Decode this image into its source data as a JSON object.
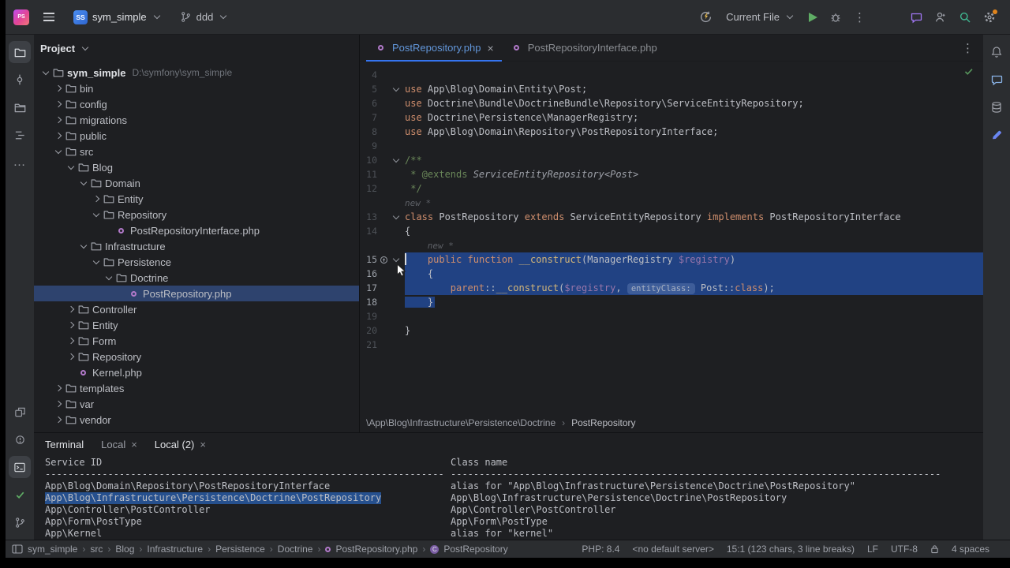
{
  "palette": {
    "accent": "#3574f0",
    "sel": "#214283",
    "treesel": "#2e436e",
    "termsel": "#26508e",
    "modblue": "#6296d9",
    "php": "#b179c9",
    "green": "#5fad65",
    "checkgreen": "#57965c",
    "teal": "#3fb58f",
    "aipurple": "#a177f4",
    "orange": "#e0841c",
    "bolt": "#f0c050"
  },
  "toolbar": {
    "app_initials": "PS",
    "project_badge": "SS",
    "project_name": "sym_simple",
    "vcs_branch": "ddd",
    "run_config": "Current File"
  },
  "left_bar": {
    "top": [
      "project",
      "commit",
      "packages",
      "structure",
      "more"
    ],
    "bottom": [
      "services",
      "problems",
      "terminal",
      "checks",
      "vcs"
    ],
    "active": [
      "project",
      "terminal"
    ]
  },
  "right_bar": [
    "notifications",
    "ai-assistant",
    "database",
    "ai-edit"
  ],
  "project": {
    "title": "Project",
    "tree": [
      {
        "label": "sym_simple",
        "depth": 0,
        "kind": "root",
        "state": "open",
        "suffix": "D:\\symfony\\sym_simple"
      },
      {
        "label": "bin",
        "depth": 1,
        "kind": "folder",
        "state": "closed"
      },
      {
        "label": "config",
        "depth": 1,
        "kind": "folder",
        "state": "closed"
      },
      {
        "label": "migrations",
        "depth": 1,
        "kind": "folder",
        "state": "closed"
      },
      {
        "label": "public",
        "depth": 1,
        "kind": "folder",
        "state": "closed"
      },
      {
        "label": "src",
        "depth": 1,
        "kind": "folder",
        "state": "open"
      },
      {
        "label": "Blog",
        "depth": 2,
        "kind": "folder",
        "state": "open"
      },
      {
        "label": "Domain",
        "depth": 3,
        "kind": "folder",
        "state": "open"
      },
      {
        "label": "Entity",
        "depth": 4,
        "kind": "folder",
        "state": "closed"
      },
      {
        "label": "Repository",
        "depth": 4,
        "kind": "folder",
        "state": "open"
      },
      {
        "label": "PostRepositoryInterface.php",
        "depth": 5,
        "kind": "file"
      },
      {
        "label": "Infrastructure",
        "depth": 3,
        "kind": "folder",
        "state": "open"
      },
      {
        "label": "Persistence",
        "depth": 4,
        "kind": "folder",
        "state": "open"
      },
      {
        "label": "Doctrine",
        "depth": 5,
        "kind": "folder",
        "state": "open"
      },
      {
        "label": "PostRepository.php",
        "depth": 6,
        "kind": "file",
        "selected": true
      },
      {
        "label": "Controller",
        "depth": 2,
        "kind": "folder",
        "state": "closed"
      },
      {
        "label": "Entity",
        "depth": 2,
        "kind": "folder",
        "state": "closed"
      },
      {
        "label": "Form",
        "depth": 2,
        "kind": "folder",
        "state": "closed"
      },
      {
        "label": "Repository",
        "depth": 2,
        "kind": "folder",
        "state": "closed"
      },
      {
        "label": "Kernel.php",
        "depth": 2,
        "kind": "file"
      },
      {
        "label": "templates",
        "depth": 1,
        "kind": "folder",
        "state": "closed"
      },
      {
        "label": "var",
        "depth": 1,
        "kind": "folder",
        "state": "closed"
      },
      {
        "label": "vendor",
        "depth": 1,
        "kind": "folder",
        "state": "closed"
      }
    ]
  },
  "editor": {
    "tabs": [
      {
        "label": "PostRepository.php",
        "active": true,
        "closable": true
      },
      {
        "label": "PostRepositoryInterface.php",
        "active": false
      }
    ],
    "lines": [
      {
        "n": 4,
        "tokens": []
      },
      {
        "n": 5,
        "fold": true,
        "tokens": [
          [
            "kw",
            "use"
          ],
          [
            "t",
            " App\\Blog\\Domain\\Entity\\Post;"
          ]
        ]
      },
      {
        "n": 6,
        "tokens": [
          [
            "kw",
            "use"
          ],
          [
            "t",
            " Doctrine\\Bundle\\DoctrineBundle\\Repository\\ServiceEntityRepository;"
          ]
        ]
      },
      {
        "n": 7,
        "tokens": [
          [
            "kw",
            "use"
          ],
          [
            "t",
            " Doctrine\\Persistence\\ManagerRegistry;"
          ]
        ]
      },
      {
        "n": 8,
        "tokens": [
          [
            "kw",
            "use"
          ],
          [
            "t",
            " App\\Blog\\Domain\\Repository\\PostRepositoryInterface;"
          ]
        ]
      },
      {
        "n": 9,
        "tokens": []
      },
      {
        "n": 10,
        "fold": true,
        "tokens": [
          [
            "doc",
            "/**"
          ]
        ]
      },
      {
        "n": 11,
        "tokens": [
          [
            "doc",
            " * @extends "
          ],
          [
            "docref",
            "ServiceEntityRepository<Post>"
          ]
        ]
      },
      {
        "n": 12,
        "tokens": [
          [
            "doc",
            " */"
          ]
        ]
      },
      {
        "cv": "new *",
        "indent": 0
      },
      {
        "n": 13,
        "fold": true,
        "tokens": [
          [
            "kw",
            "class"
          ],
          [
            "t",
            " PostRepository "
          ],
          [
            "kw",
            "extends"
          ],
          [
            "t",
            " ServiceEntityRepository "
          ],
          [
            "kw",
            "implements"
          ],
          [
            "t",
            " PostRepositoryInterface"
          ]
        ]
      },
      {
        "n": 14,
        "tokens": [
          [
            "t",
            "{"
          ]
        ]
      },
      {
        "cv": "new *",
        "indent": 4
      },
      {
        "n": 15,
        "hl": true,
        "sel": "full",
        "fold": true,
        "gutter": "impl",
        "caret": true,
        "tokens": [
          [
            "t",
            "    "
          ],
          [
            "kw",
            "public"
          ],
          [
            "t",
            " "
          ],
          [
            "kw",
            "function"
          ],
          [
            "t",
            " "
          ],
          [
            "fn",
            "__construct"
          ],
          [
            "t",
            "(ManagerRegistry "
          ],
          [
            "var",
            "$registry"
          ],
          [
            "t",
            ")"
          ]
        ]
      },
      {
        "n": 16,
        "hl": true,
        "sel": "full",
        "tokens": [
          [
            "t",
            "    {"
          ]
        ]
      },
      {
        "n": 17,
        "hl": true,
        "sel": "full",
        "tokens": [
          [
            "t",
            "        "
          ],
          [
            "kw",
            "parent"
          ],
          [
            "t",
            "::"
          ],
          [
            "fn",
            "__construct"
          ],
          [
            "t",
            "("
          ],
          [
            "var",
            "$registry"
          ],
          [
            "t",
            ", "
          ],
          [
            "hint",
            "entityClass:"
          ],
          [
            "t",
            " Post::"
          ],
          [
            "kw",
            "class"
          ],
          [
            "t",
            ");"
          ]
        ]
      },
      {
        "n": 18,
        "hl": true,
        "sel": "text",
        "tokens": [
          [
            "t",
            "    }"
          ]
        ]
      },
      {
        "n": 19,
        "tokens": []
      },
      {
        "n": 20,
        "tokens": [
          [
            "t",
            "}"
          ]
        ]
      },
      {
        "n": 21,
        "tokens": []
      }
    ],
    "breadcrumb": [
      "\\App\\Blog\\Infrastructure\\Persistence\\Doctrine",
      "PostRepository"
    ]
  },
  "terminal": {
    "title": "Terminal",
    "tabs": [
      {
        "label": "Local",
        "active": false
      },
      {
        "label": "Local (2)",
        "active": true
      }
    ],
    "output": {
      "columns": [
        "Service ID",
        "Class name"
      ],
      "sep1": 70,
      "sep2": 86,
      "selected_row": 1,
      "rows": [
        [
          "App\\Blog\\Domain\\Repository\\PostRepositoryInterface",
          "alias for \"App\\Blog\\Infrastructure\\Persistence\\Doctrine\\PostRepository\""
        ],
        [
          "App\\Blog\\Infrastructure\\Persistence\\Doctrine\\PostRepository",
          "App\\Blog\\Infrastructure\\Persistence\\Doctrine\\PostRepository"
        ],
        [
          "App\\Controller\\PostController",
          "App\\Controller\\PostController"
        ],
        [
          "App\\Form\\PostType",
          "App\\Form\\PostType"
        ],
        [
          "App\\Kernel",
          "alias for \"kernel\""
        ]
      ]
    }
  },
  "status_bar": {
    "path": [
      "sym_simple",
      "src",
      "Blog",
      "Infrastructure",
      "Persistence",
      "Doctrine",
      "PostRepository.php",
      "PostRepository"
    ],
    "items": [
      "PHP: 8.4",
      "<no default server>",
      "15:1 (123 chars, 3 line breaks)",
      "LF",
      "UTF-8",
      "4 spaces"
    ]
  }
}
